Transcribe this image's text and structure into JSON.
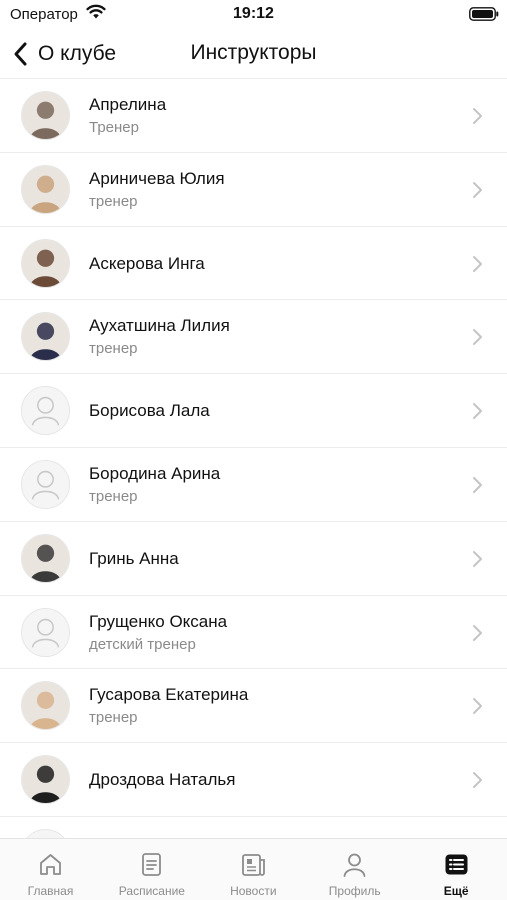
{
  "status_bar": {
    "carrier": "Оператор",
    "time": "19:12"
  },
  "nav": {
    "back_label": "О клубе",
    "title": "Инструкторы"
  },
  "instructors": [
    {
      "name": "Апрелина",
      "role": "Тренер",
      "avatar": "photo",
      "tone": "#7b6a5d"
    },
    {
      "name": "Ариничева Юлия",
      "role": "тренер",
      "avatar": "photo",
      "tone": "#c9a57f"
    },
    {
      "name": "Аскерова Инга",
      "role": "",
      "avatar": "photo",
      "tone": "#6b4a38"
    },
    {
      "name": "Аухатшина Лилия",
      "role": "тренер",
      "avatar": "photo",
      "tone": "#2b2e4a"
    },
    {
      "name": "Борисова Лала",
      "role": "",
      "avatar": "placeholder",
      "tone": "#cfcfcf"
    },
    {
      "name": "Бородина Арина",
      "role": "тренер",
      "avatar": "placeholder",
      "tone": "#cfcfcf"
    },
    {
      "name": "Гринь Анна",
      "role": "",
      "avatar": "photo",
      "tone": "#3a3a3a"
    },
    {
      "name": "Грущенко Оксана",
      "role": "детский тренер",
      "avatar": "placeholder",
      "tone": "#cfcfcf"
    },
    {
      "name": "Гусарова Екатерина",
      "role": "тренер",
      "avatar": "photo",
      "tone": "#d8b48f"
    },
    {
      "name": "Дроздова Наталья",
      "role": "",
      "avatar": "photo",
      "tone": "#1e1e1e"
    },
    {
      "name": "",
      "role": "",
      "avatar": "placeholder",
      "tone": "#cfcfcf"
    }
  ],
  "tabs": [
    {
      "label": "Главная",
      "icon": "home-icon",
      "active": false
    },
    {
      "label": "Расписание",
      "icon": "schedule-icon",
      "active": false
    },
    {
      "label": "Новости",
      "icon": "news-icon",
      "active": false
    },
    {
      "label": "Профиль",
      "icon": "profile-icon",
      "active": false
    },
    {
      "label": "Ещё",
      "icon": "more-list-icon",
      "active": true
    }
  ],
  "colors": {
    "text": "#111111",
    "secondary": "#8a8a8a",
    "divider": "#ececec",
    "tab_inactive": "#8c8c8c"
  }
}
